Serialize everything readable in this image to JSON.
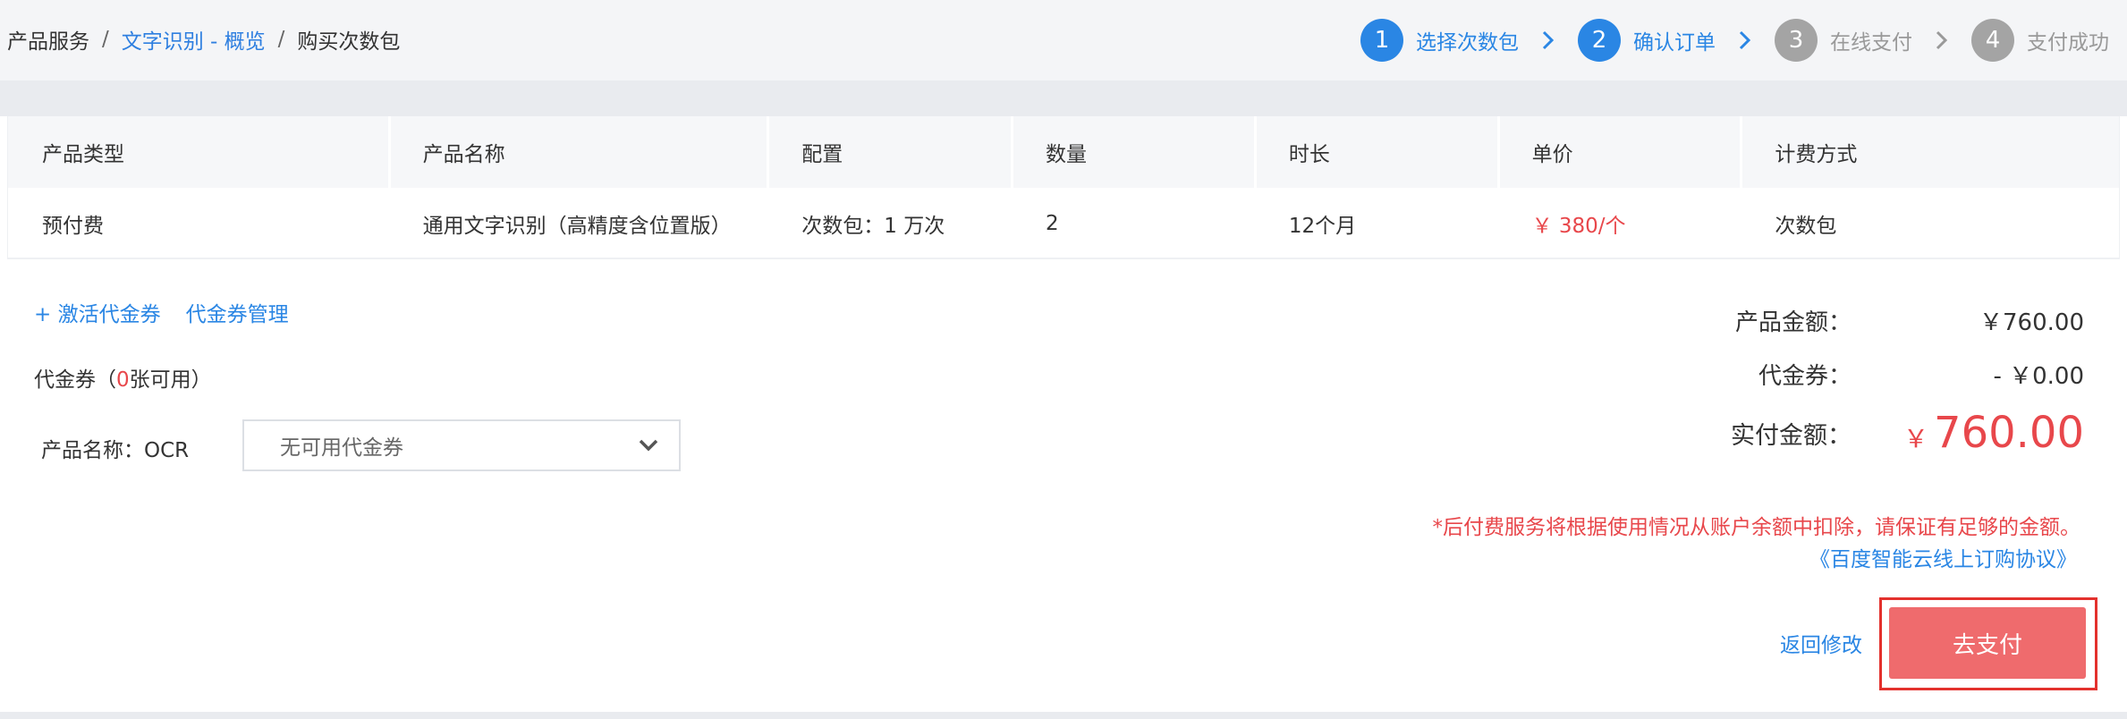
{
  "breadcrumb": {
    "root": "产品服务",
    "sep1": "/",
    "overview": "文字识别 - 概览",
    "sep2": "/",
    "current": "购买次数包"
  },
  "steps": [
    {
      "num": "1",
      "label": "选择次数包",
      "active": true
    },
    {
      "num": "2",
      "label": "确认订单",
      "active": true
    },
    {
      "num": "3",
      "label": "在线支付",
      "active": false
    },
    {
      "num": "4",
      "label": "支付成功",
      "active": false
    }
  ],
  "table": {
    "headers": [
      "产品类型",
      "产品名称",
      "配置",
      "数量",
      "时长",
      "单价",
      "计费方式"
    ],
    "row": [
      "预付费",
      "通用文字识别（高精度含位置版）",
      "次数包：1 万次",
      "2",
      "12个月",
      "￥ 380/个",
      "次数包"
    ]
  },
  "coupon": {
    "activate_link": "+ 激活代金券",
    "manage_link": "代金券管理",
    "count_prefix": "代金券（",
    "count_num": "0",
    "count_suffix": "张可用）",
    "product_label": "产品名称：OCR",
    "select_value": "无可用代金券"
  },
  "summary": {
    "product_amount_label": "产品金额：",
    "product_amount_value": "￥760.00",
    "coupon_label": "代金券：",
    "coupon_value": "- ￥0.00",
    "paid_label": "实付金额：",
    "paid_currency": "￥",
    "paid_amount": "760.00"
  },
  "notice": "*后付费服务将根据使用情况从账户余额中扣除，请保证有足够的金额。",
  "agreement_link": "《百度智能云线上订购协议》",
  "actions": {
    "back_label": "返回修改",
    "pay_label": "去支付"
  },
  "colors": {
    "accent": "#2a86e4",
    "price_red": "#e8474b",
    "pay_button": "#ef6b6d",
    "highlight_outline": "#e3312d",
    "inactive_step": "#a4a4a4"
  }
}
